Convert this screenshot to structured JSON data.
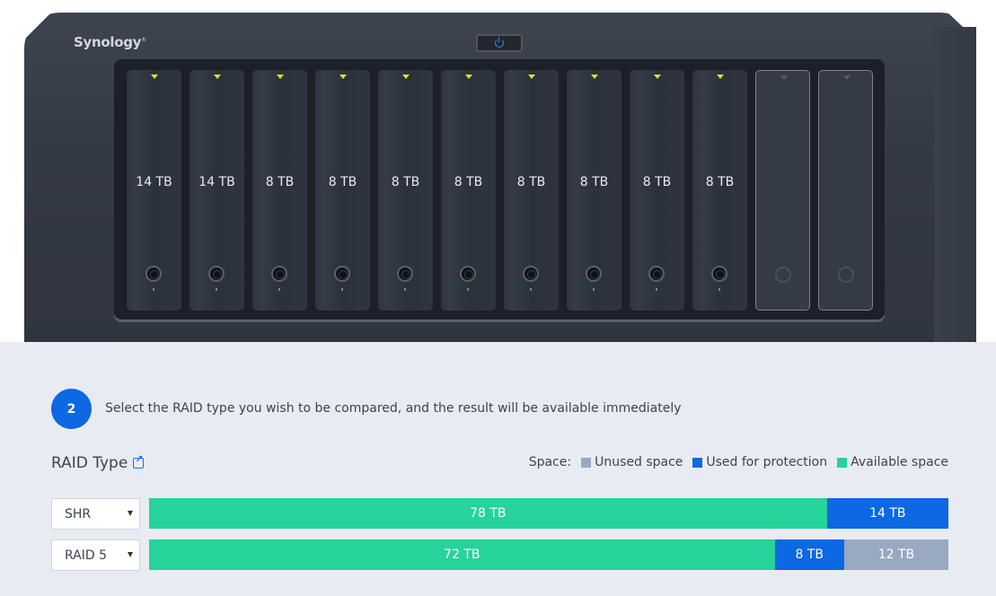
{
  "device": {
    "brand": "Synology",
    "brand_mark": "®",
    "power_icon": "power-icon",
    "bays": [
      {
        "label": "14 TB",
        "installed": true
      },
      {
        "label": "14 TB",
        "installed": true
      },
      {
        "label": "8 TB",
        "installed": true
      },
      {
        "label": "8 TB",
        "installed": true
      },
      {
        "label": "8 TB",
        "installed": true
      },
      {
        "label": "8 TB",
        "installed": true
      },
      {
        "label": "8 TB",
        "installed": true
      },
      {
        "label": "8 TB",
        "installed": true
      },
      {
        "label": "8 TB",
        "installed": true
      },
      {
        "label": "8 TB",
        "installed": true
      },
      {
        "label": "",
        "installed": false
      },
      {
        "label": "",
        "installed": false
      }
    ]
  },
  "step": {
    "number": "2",
    "instruction": "Select the RAID type you wish to be compared, and the result will be available immediately"
  },
  "raid_section": {
    "title": "RAID Type",
    "link_icon": "external-link-icon",
    "legend": {
      "label": "Space:",
      "items": [
        {
          "key": "unused",
          "label": "Unused space",
          "color": "#99a9c1"
        },
        {
          "key": "protection",
          "label": "Used for protection",
          "color": "#0c68e3"
        },
        {
          "key": "available",
          "label": "Available space",
          "color": "#26d39a"
        }
      ]
    },
    "rows": [
      {
        "raid_type": "SHR",
        "segments": [
          {
            "key": "available",
            "value": 78,
            "label": "78 TB"
          },
          {
            "key": "protection",
            "value": 14,
            "label": "14 TB"
          }
        ]
      },
      {
        "raid_type": "RAID 5",
        "segments": [
          {
            "key": "available",
            "value": 72,
            "label": "72 TB"
          },
          {
            "key": "protection",
            "value": 8,
            "label": "8 TB"
          },
          {
            "key": "unused",
            "value": 12,
            "label": "12 TB"
          }
        ]
      }
    ]
  }
}
